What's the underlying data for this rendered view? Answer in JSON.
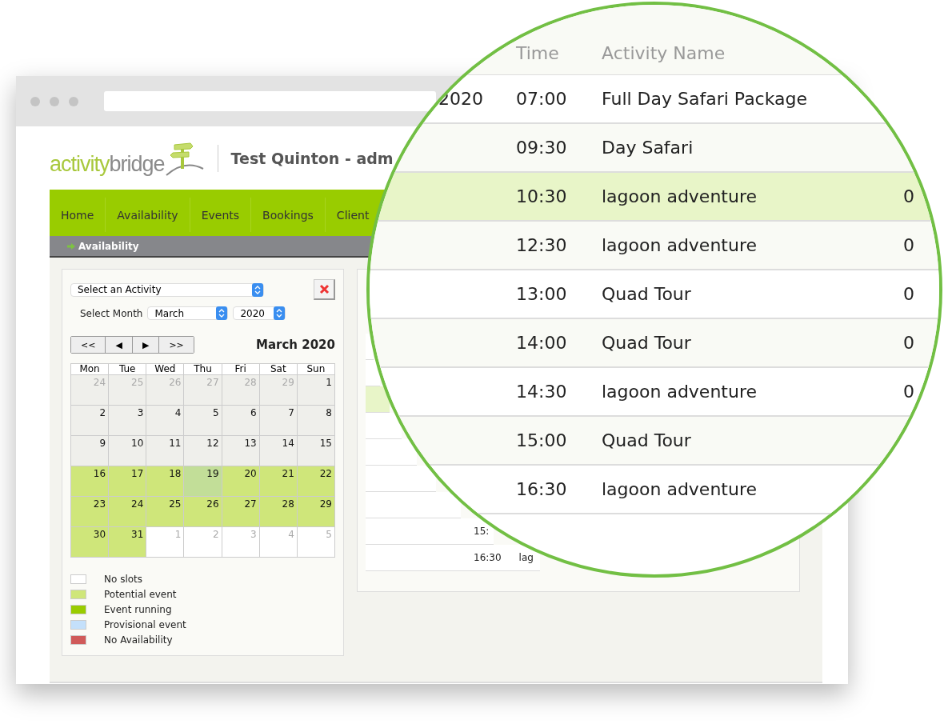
{
  "logo": {
    "first": "activity",
    "second": "bridge"
  },
  "account_title": "Test Quinton - adm",
  "nav": [
    {
      "label": "Home",
      "selected": false
    },
    {
      "label": "Availability",
      "selected": false
    },
    {
      "label": "Events",
      "selected": false
    },
    {
      "label": "Bookings",
      "selected": false
    },
    {
      "label": "Client",
      "selected": false
    }
  ],
  "breadcrumb": "Availability",
  "filters": {
    "activity": "Select an Activity",
    "month_label": "Select Month",
    "month": "March",
    "year": "2020"
  },
  "calendar": {
    "nav_buttons": [
      "<<",
      "◀",
      "▶",
      ">>"
    ],
    "title": "March 2020",
    "weekdays": [
      "Mon",
      "Tue",
      "Wed",
      "Thu",
      "Fri",
      "Sat",
      "Sun"
    ],
    "days": [
      {
        "day": "24",
        "kind": "past",
        "muted": true
      },
      {
        "day": "25",
        "kind": "past",
        "muted": true
      },
      {
        "day": "26",
        "kind": "past",
        "muted": true
      },
      {
        "day": "27",
        "kind": "past",
        "muted": true
      },
      {
        "day": "28",
        "kind": "past",
        "muted": true
      },
      {
        "day": "29",
        "kind": "past",
        "muted": true
      },
      {
        "day": "1",
        "kind": "past",
        "muted": false
      },
      {
        "day": "2",
        "kind": "past",
        "muted": false
      },
      {
        "day": "3",
        "kind": "past",
        "muted": false
      },
      {
        "day": "4",
        "kind": "past",
        "muted": false
      },
      {
        "day": "5",
        "kind": "past",
        "muted": false
      },
      {
        "day": "6",
        "kind": "past",
        "muted": false
      },
      {
        "day": "7",
        "kind": "past",
        "muted": false
      },
      {
        "day": "8",
        "kind": "past",
        "muted": false
      },
      {
        "day": "9",
        "kind": "past",
        "muted": false
      },
      {
        "day": "10",
        "kind": "past",
        "muted": false
      },
      {
        "day": "11",
        "kind": "past",
        "muted": false
      },
      {
        "day": "12",
        "kind": "past",
        "muted": false
      },
      {
        "day": "13",
        "kind": "past",
        "muted": false
      },
      {
        "day": "14",
        "kind": "past",
        "muted": false
      },
      {
        "day": "15",
        "kind": "past",
        "muted": false
      },
      {
        "day": "16",
        "kind": "potential",
        "muted": false
      },
      {
        "day": "17",
        "kind": "potential",
        "muted": false
      },
      {
        "day": "18",
        "kind": "potential",
        "muted": false
      },
      {
        "day": "19",
        "kind": "today",
        "muted": false
      },
      {
        "day": "20",
        "kind": "potential",
        "muted": false
      },
      {
        "day": "21",
        "kind": "potential",
        "muted": false
      },
      {
        "day": "22",
        "kind": "potential",
        "muted": false
      },
      {
        "day": "23",
        "kind": "potential",
        "muted": false
      },
      {
        "day": "24",
        "kind": "potential",
        "muted": false
      },
      {
        "day": "25",
        "kind": "potential",
        "muted": false
      },
      {
        "day": "26",
        "kind": "potential",
        "muted": false
      },
      {
        "day": "27",
        "kind": "potential",
        "muted": false
      },
      {
        "day": "28",
        "kind": "potential",
        "muted": false
      },
      {
        "day": "29",
        "kind": "potential",
        "muted": false
      },
      {
        "day": "30",
        "kind": "potential",
        "muted": false
      },
      {
        "day": "31",
        "kind": "potential",
        "muted": false
      },
      {
        "day": "1",
        "kind": "none",
        "muted": true
      },
      {
        "day": "2",
        "kind": "none",
        "muted": true
      },
      {
        "day": "3",
        "kind": "none",
        "muted": true
      },
      {
        "day": "4",
        "kind": "none",
        "muted": true
      },
      {
        "day": "5",
        "kind": "none",
        "muted": true
      }
    ]
  },
  "legend": [
    {
      "label": "No slots",
      "color": "#ffffff"
    },
    {
      "label": "Potential event",
      "color": "#cfe67a"
    },
    {
      "label": "Event running",
      "color": "#99cc00"
    },
    {
      "label": "Provisional event",
      "color": "#c4e0fb"
    },
    {
      "label": "No Availability",
      "color": "#d05a5a"
    }
  ],
  "schedule_rows": [
    {
      "highlighted": false
    },
    {
      "highlighted": false
    },
    {
      "highlighted": true
    },
    {
      "highlighted": false
    },
    {
      "highlighted": false
    },
    {
      "highlighted": false
    },
    {
      "highlighted": false
    },
    {
      "time": "15:",
      "highlighted": false
    },
    {
      "time": "16:30",
      "name": "lag",
      "highlighted": false
    }
  ],
  "magnifier": {
    "columns": {
      "time": "Time",
      "activity": "Activity Name"
    },
    "rows": [
      {
        "date": "2020",
        "time": "07:00",
        "name": "Full Day Safari Package",
        "highlighted": false
      },
      {
        "time": "09:30",
        "name": "Day Safari",
        "highlighted": false
      },
      {
        "time": "10:30",
        "name": "lagoon adventure",
        "count": "0",
        "highlighted": true
      },
      {
        "time": "12:30",
        "name": "lagoon adventure",
        "count": "0",
        "highlighted": false
      },
      {
        "time": "13:00",
        "name": "Quad Tour",
        "count": "0",
        "highlighted": false
      },
      {
        "time": "14:00",
        "name": "Quad Tour",
        "count": "0",
        "highlighted": false
      },
      {
        "time": "14:30",
        "name": "lagoon adventure",
        "count": "0",
        "highlighted": false
      },
      {
        "time": "15:00",
        "name": "Quad Tour",
        "highlighted": false
      },
      {
        "time": "16:30",
        "name": "lagoon adventure",
        "highlighted": false
      }
    ]
  }
}
